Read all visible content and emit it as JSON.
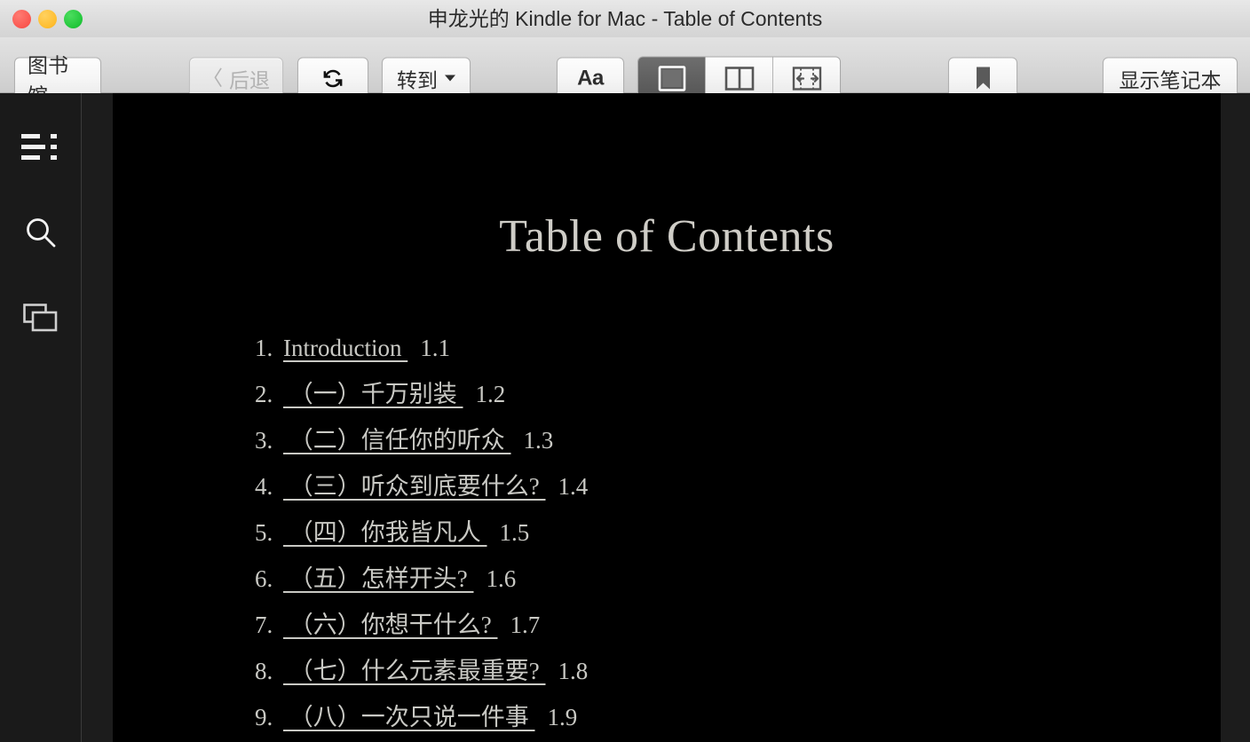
{
  "window": {
    "title": "申龙光的 Kindle for Mac - Table of Contents",
    "traffic_lights": {
      "close": "close-button",
      "minimize": "minimize-button",
      "maximize": "maximize-button"
    },
    "colors": {
      "close": "#fa5750",
      "minimize": "#ffbd2e",
      "maximize": "#21c63a",
      "toolbar_bg": "#d8d8d8",
      "content_bg": "#000000",
      "sidebar_bg": "#1a1a1a",
      "text": "#c9c9c4",
      "segment_active_bg": "#616161"
    }
  },
  "toolbar": {
    "library_label": "图书馆",
    "back_label": "后退",
    "back_arrow": "〈",
    "back_disabled": true,
    "sync_icon": "sync-icon",
    "goto_label": "转到",
    "goto_chevron": "chevron-down-icon",
    "font_label": "Aa",
    "bookmark_icon": "bookmark-icon",
    "notebook_label": "显示笔记本",
    "view_modes": [
      {
        "name": "single-page",
        "icon": "single-page-icon",
        "active": true
      },
      {
        "name": "two-column",
        "icon": "two-column-icon",
        "active": false
      },
      {
        "name": "fit-width",
        "icon": "fit-width-icon",
        "active": false
      }
    ]
  },
  "sidebar": {
    "items": [
      {
        "name": "table-of-contents",
        "icon": "list-icon"
      },
      {
        "name": "search",
        "icon": "search-icon"
      },
      {
        "name": "notes-cards",
        "icon": "cards-icon"
      }
    ]
  },
  "document": {
    "title": "Table of Contents",
    "entries": [
      {
        "label": "Introduction ",
        "number": "1.1"
      },
      {
        "label": " （一）千万别装 ",
        "number": "1.2"
      },
      {
        "label": " （二）信任你的听众 ",
        "number": "1.3"
      },
      {
        "label": " （三）听众到底要什么? ",
        "number": "1.4"
      },
      {
        "label": " （四）你我皆凡人 ",
        "number": "1.5"
      },
      {
        "label": " （五）怎样开头? ",
        "number": "1.6"
      },
      {
        "label": " （六）你想干什么? ",
        "number": "1.7"
      },
      {
        "label": " （七）什么元素最重要? ",
        "number": "1.8"
      },
      {
        "label": " （八）一次只说一件事 ",
        "number": "1.9"
      }
    ]
  }
}
